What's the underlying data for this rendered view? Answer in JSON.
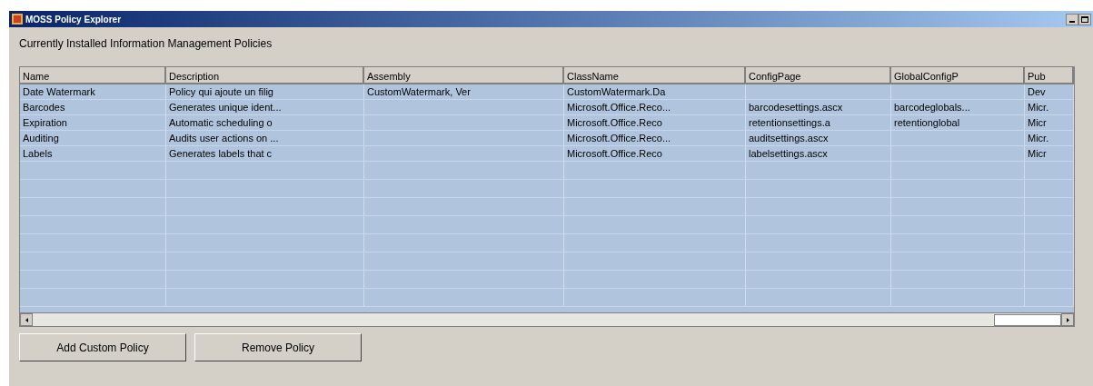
{
  "window": {
    "title": "MOSS Policy Explorer"
  },
  "heading": "Currently Installed Information Management Policies",
  "table": {
    "columns": [
      "Name",
      "Description",
      "Assembly",
      "ClassName",
      "ConfigPage",
      "GlobalConfigP",
      "Pub"
    ],
    "rows": [
      {
        "cells": [
          "Date Watermark",
          "Policy qui ajoute un filig",
          "CustomWatermark, Ver",
          "CustomWatermark.Da",
          "",
          "",
          "Dev"
        ]
      },
      {
        "cells": [
          "Barcodes",
          "Generates unique ident...",
          "",
          "Microsoft.Office.Reco...",
          "barcodesettings.ascx",
          "barcodeglobals...",
          "Micr."
        ]
      },
      {
        "cells": [
          "Expiration",
          "Automatic scheduling o",
          "",
          "Microsoft.Office.Reco",
          "retentionsettings.a",
          "retentionglobal",
          "Micr"
        ]
      },
      {
        "cells": [
          "Auditing",
          "Audits user actions on ...",
          "",
          "Microsoft.Office.Reco...",
          "auditsettings.ascx",
          "",
          "Micr."
        ]
      },
      {
        "cells": [
          "Labels",
          "Generates labels that c",
          "",
          "Microsoft.Office.Reco",
          "labelsettings.ascx",
          "",
          "Micr"
        ]
      }
    ]
  },
  "buttons": [
    "Add Custom Policy",
    "Remove Policy"
  ]
}
